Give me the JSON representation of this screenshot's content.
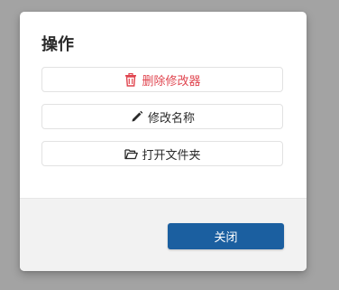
{
  "dialog": {
    "title": "操作",
    "actions": [
      {
        "label": "删除修改器",
        "icon": "trash-icon",
        "color": "#e0454f"
      },
      {
        "label": "修改名称",
        "icon": "pencil-icon",
        "color": "#2a2a2a"
      },
      {
        "label": "打开文件夹",
        "icon": "folder-open-icon",
        "color": "#2a2a2a"
      }
    ],
    "close_label": "关闭",
    "close_color": "#1b5fa0"
  }
}
